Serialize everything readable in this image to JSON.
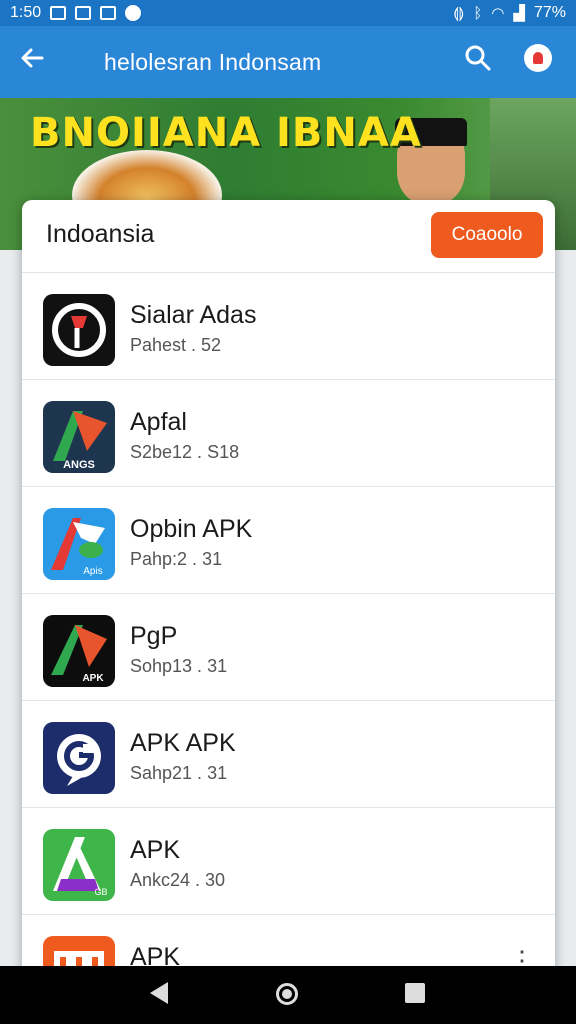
{
  "status_bar": {
    "time": "1:50",
    "battery": "77%"
  },
  "app_bar": {
    "title": "helolesran Indonsam"
  },
  "banner": {
    "headline": "BNOIIANA IBNAA"
  },
  "dialog": {
    "title": "Indoansia",
    "cancel_label": "Coaoolo",
    "apps": [
      {
        "name": "Sialar Adas",
        "meta": "Pahest . 52",
        "icon": "black-red-app-icon"
      },
      {
        "name": "Apfal",
        "meta": "S2be12 . S18",
        "icon": "green-red-a-icon"
      },
      {
        "name": "Opbin APK",
        "meta": "Pahp:2 . 31",
        "icon": "blue-red-a-icon"
      },
      {
        "name": "PgP",
        "meta": "Sohp13 . 31",
        "icon": "black-green-a-icon"
      },
      {
        "name": "APK APK",
        "meta": "Sahp21 . 31",
        "icon": "navy-g-icon"
      },
      {
        "name": "APK",
        "meta": "Ankc24 . 30",
        "icon": "green-purple-a-icon"
      },
      {
        "name": "APK",
        "meta": "",
        "icon": "orange-m-icon"
      }
    ]
  },
  "icon_badges": {
    "app2": "ANGS",
    "app3": "Apis",
    "app4": "APK",
    "app6": "GB"
  }
}
